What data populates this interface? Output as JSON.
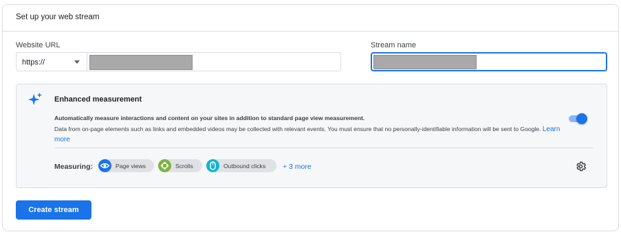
{
  "card": {
    "title": "Set up your web stream"
  },
  "website_url": {
    "label": "Website URL",
    "protocol": "https://",
    "value_redacted": true
  },
  "stream_name": {
    "label": "Stream name",
    "value_redacted": true
  },
  "enhanced_measurement": {
    "title": "Enhanced measurement",
    "description_bold": "Automatically measure interactions and content on your sites in addition to standard page view measurement.",
    "description": "Data from on-page elements such as links and embedded videos may be collected with relevant events. You must ensure that no personally-identifiable information will be sent to Google.",
    "learn_more": "Learn more",
    "enabled": true,
    "measuring_label": "Measuring:",
    "chips": [
      {
        "label": "Page views",
        "icon": "eye-icon",
        "color": "#1a73e8"
      },
      {
        "label": "Scrolls",
        "icon": "scroll-arrows-icon",
        "color": "#7cb342"
      },
      {
        "label": "Outbound clicks",
        "icon": "mouse-icon",
        "color": "#12b5cb"
      }
    ],
    "more_link": "+ 3 more"
  },
  "create_button": {
    "label": "Create stream"
  },
  "colors": {
    "accent": "#1a73e8",
    "border": "#dadce0",
    "panel_bg": "#f6f7f9"
  }
}
